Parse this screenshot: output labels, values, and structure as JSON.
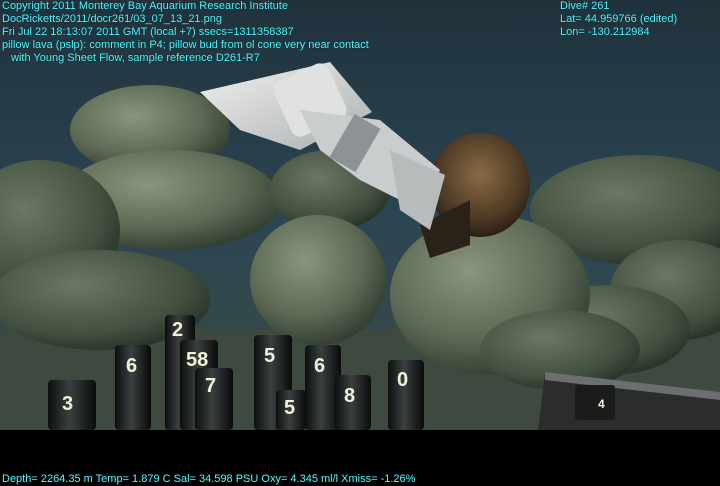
{
  "overlay": {
    "copyright": "Copyright 2011 Monterey Bay Aquarium Research Institute",
    "file": "DocRicketts/2011/docr261/03_07_13_21.png",
    "datetime": "Fri Jul 22 18:13:07 2011 GMT (local +7)  ssecs=1311358387",
    "comment_line1": "pillow lava (pslp): comment in P4; pillow bud from ol cone very near contact",
    "comment_line2": "with Young Sheet Flow, sample reference D261-R7",
    "dive": "Dive# 261",
    "lat": "Lat= 44.959766 (edited)",
    "lon": "Lon= -130.212984",
    "telemetry": "Depth= 2264.35 m  Temp= 1.879 C  Sal= 34.598 PSU  Oxy= 4.345 ml/l  Xmiss= -1.26%"
  },
  "sample_tubes": {
    "labels": [
      "3",
      "6",
      "58",
      "7",
      "5",
      "6",
      "2",
      "8",
      "0",
      "5",
      "4"
    ]
  },
  "colors": {
    "overlay_text": "#4ff6ff",
    "seafloor": "#3f4a3c",
    "water": "#1e3a4a"
  }
}
